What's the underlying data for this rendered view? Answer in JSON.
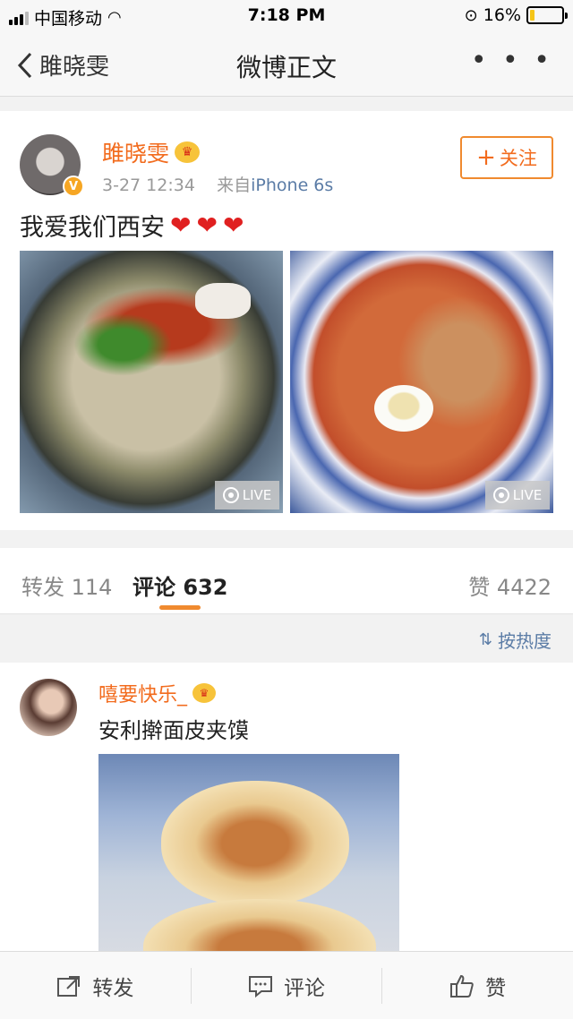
{
  "status_bar": {
    "carrier": "中国移动",
    "time": "7:18 PM",
    "battery": "16%",
    "battery_level": 0.16
  },
  "nav": {
    "back_label": "雎晓雯",
    "title": "微博正文",
    "more": "• • •"
  },
  "post": {
    "author": "雎晓雯",
    "verified_badge": "V",
    "crown": "♛",
    "timestamp": "3-27 12:34",
    "source_prefix": "来自",
    "source": "iPhone 6s",
    "follow_label": "关注",
    "follow_icon": "+",
    "text": "我爱我们西安",
    "hearts": [
      "❤",
      "❤",
      "❤"
    ],
    "images": [
      {
        "badge": "LIVE"
      },
      {
        "badge": "LIVE"
      }
    ]
  },
  "tabs": {
    "repost_label": "转发",
    "repost_count": "114",
    "comment_label": "评论",
    "comment_count": "632",
    "like_label": "赞",
    "like_count": "4422"
  },
  "sort": {
    "label": "按热度",
    "icon": "sort-icon"
  },
  "comment": {
    "author": "嘻要快乐_",
    "crown": "♛",
    "text": "安利擀面皮夹馍"
  },
  "bottom_bar": {
    "repost": "转发",
    "comment": "评论",
    "like": "赞"
  },
  "colors": {
    "accent": "#f26b1d",
    "link": "#5b7ca6",
    "underline": "#f08a2f"
  }
}
